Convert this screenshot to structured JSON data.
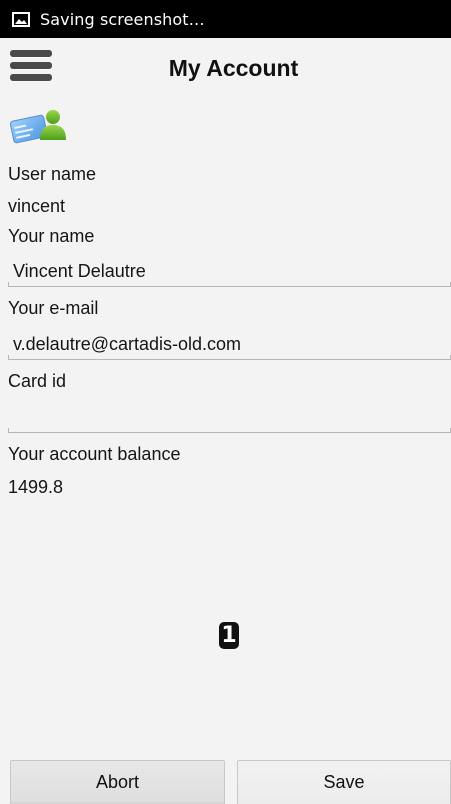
{
  "status_bar": {
    "text": "Saving screenshot…",
    "icon": "image-icon"
  },
  "header": {
    "title": "My Account",
    "menu_icon": "hamburger-menu-icon"
  },
  "account_icon": "user-card-icon",
  "form": {
    "user_name_label": "User name",
    "user_name_value": "vincent",
    "your_name_label": "Your name",
    "your_name_value": "Vincent Delautre",
    "email_label": "Your e-mail",
    "email_value": "v.delautre@cartadis-old.com",
    "card_id_label": "Card id",
    "card_id_value": "",
    "balance_label": "Your account balance",
    "balance_value": "1499.8"
  },
  "badge": "1",
  "buttons": {
    "abort_label": "Abort",
    "save_label": "Save"
  }
}
